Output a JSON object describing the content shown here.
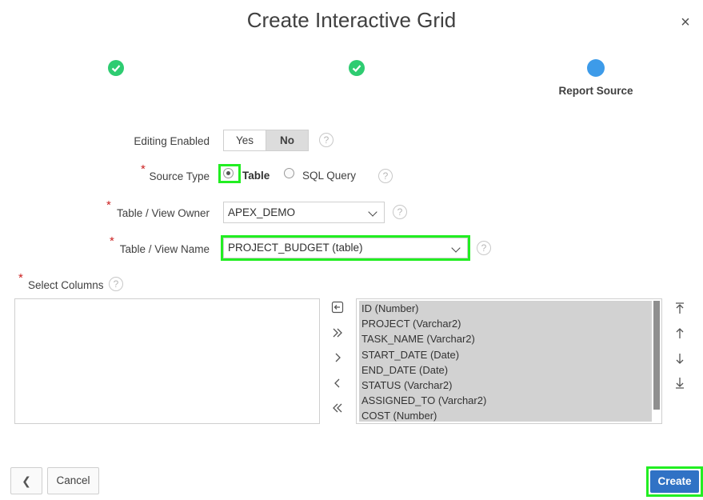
{
  "dialog": {
    "title": "Create Interactive Grid",
    "close_glyph": "×"
  },
  "steps": {
    "current_label": "Report Source"
  },
  "form": {
    "editing_enabled": {
      "label": "Editing Enabled",
      "options": [
        "Yes",
        "No"
      ],
      "selected": "No"
    },
    "source_type": {
      "label": "Source Type",
      "options": [
        "Table",
        "SQL Query"
      ],
      "selected": "Table"
    },
    "owner": {
      "label": "Table / View Owner",
      "value": "APEX_DEMO"
    },
    "table_name": {
      "label": "Table / View Name",
      "value": "PROJECT_BUDGET (table)"
    },
    "select_columns": {
      "label": "Select Columns",
      "selected_columns": [
        "ID (Number)",
        "PROJECT (Varchar2)",
        "TASK_NAME (Varchar2)",
        "START_DATE (Date)",
        "END_DATE (Date)",
        "STATUS (Varchar2)",
        "ASSIGNED_TO (Varchar2)",
        "COST (Number)"
      ]
    },
    "required_marker": "*",
    "help_glyph": "?"
  },
  "footer": {
    "back_glyph": "❮",
    "cancel_label": "Cancel",
    "create_label": "Create"
  },
  "colors": {
    "step_done": "#2ecc71",
    "step_current": "#3d9be9",
    "primary": "#3072c5",
    "highlight": "#22ee22"
  }
}
